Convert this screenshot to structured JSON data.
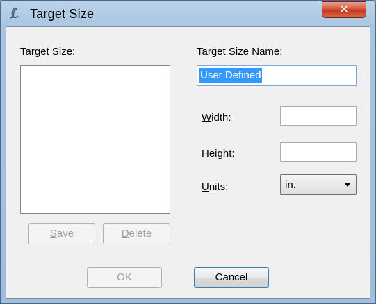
{
  "window": {
    "title": "Target Size",
    "close_glyph": "✕"
  },
  "form": {
    "target_size_label": {
      "accel": "T",
      "rest": "arget Size:"
    },
    "target_size_items": [],
    "name_label": {
      "before": "Target Size ",
      "accel": "N",
      "after": "ame:"
    },
    "name_value": "User Defined",
    "width_label": {
      "accel": "W",
      "rest": "idth:"
    },
    "width_value": "",
    "height_label": {
      "accel": "H",
      "rest": "eight:"
    },
    "height_value": "",
    "units_label": {
      "accel": "U",
      "rest": "nits:"
    },
    "units_value": "in."
  },
  "buttons": {
    "save": {
      "accel": "S",
      "rest": "ave",
      "enabled": false
    },
    "delete": {
      "accel": "D",
      "rest": "elete",
      "enabled": false
    },
    "ok": {
      "label": "OK",
      "enabled": false
    },
    "cancel": {
      "label": "Cancel",
      "enabled": true
    }
  },
  "icons": {
    "app": "app-icon",
    "close": "close-icon",
    "dropdown": "chevron-down-icon"
  }
}
